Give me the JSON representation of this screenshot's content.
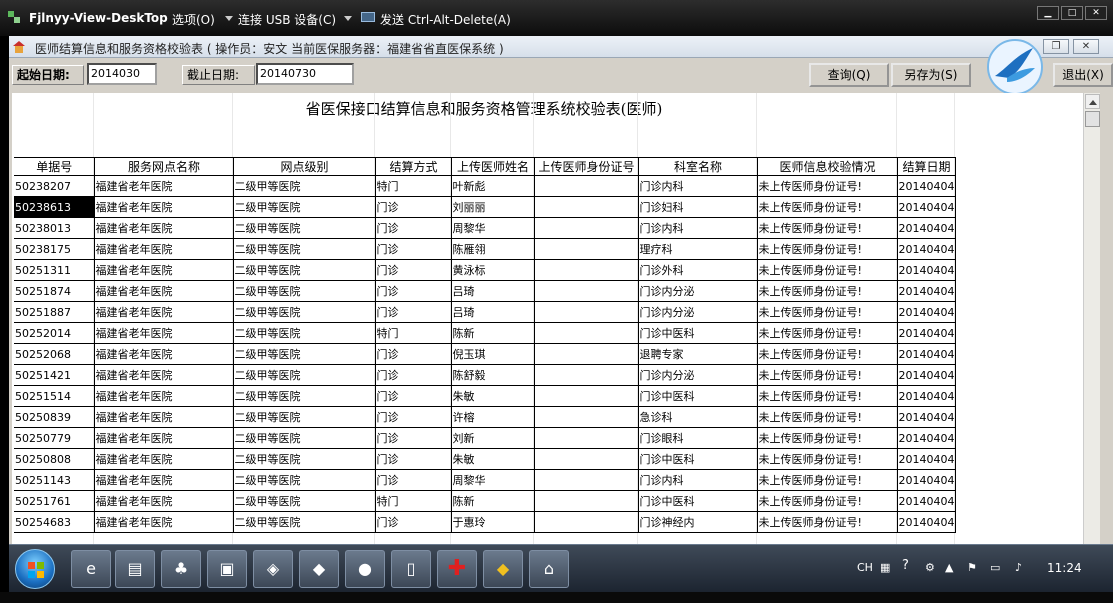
{
  "viewer": {
    "title": "Fjlnyy-View-DeskTop",
    "menus": [
      "选项(O)",
      "连接 USB 设备(C)",
      "发送 Ctrl-Alt-Delete(A)"
    ],
    "window_buttons": [
      "▁",
      "□",
      "✕"
    ]
  },
  "app": {
    "title": "医师结算信息和服务资格校验表 ( 操作员：安文 当前医保服务器：福建省省直医保系统 )",
    "title_buttons": [
      "❐",
      "✕"
    ],
    "start_label": "起始日期:",
    "start_value": "2014030",
    "end_label": "截止日期:",
    "end_value": "20140730",
    "btn_query": "查询(Q)",
    "btn_saveas": "另存为(S)",
    "btn_exit": "退出(X)"
  },
  "report": {
    "title": "省医保接口结算信息和服务资格管理系统校验表(医师)",
    "columns": [
      "单据号",
      "服务网点名称",
      "网点级别",
      "结算方式",
      "上传医师姓名",
      "上传医师身份证号",
      "科室名称",
      "医师信息校验情况",
      "结算日期"
    ],
    "rows": [
      [
        "50238207",
        "福建省老年医院",
        "二级甲等医院",
        "特门",
        "叶新彪",
        "",
        "门诊内科",
        "未上传医师身份证号!",
        "20140404"
      ],
      [
        "50238613",
        "福建省老年医院",
        "二级甲等医院",
        "门诊",
        "刘丽丽",
        "",
        "门诊妇科",
        "未上传医师身份证号!",
        "20140404"
      ],
      [
        "50238013",
        "福建省老年医院",
        "二级甲等医院",
        "门诊",
        "周黎华",
        "",
        "门诊内科",
        "未上传医师身份证号!",
        "20140404"
      ],
      [
        "50238175",
        "福建省老年医院",
        "二级甲等医院",
        "门诊",
        "陈雁翎",
        "",
        "理疗科",
        "未上传医师身份证号!",
        "20140404"
      ],
      [
        "50251311",
        "福建省老年医院",
        "二级甲等医院",
        "门诊",
        "黄泳标",
        "",
        "门诊外科",
        "未上传医师身份证号!",
        "20140404"
      ],
      [
        "50251874",
        "福建省老年医院",
        "二级甲等医院",
        "门诊",
        "吕琦",
        "",
        "门诊内分泌",
        "未上传医师身份证号!",
        "20140404"
      ],
      [
        "50251887",
        "福建省老年医院",
        "二级甲等医院",
        "门诊",
        "吕琦",
        "",
        "门诊内分泌",
        "未上传医师身份证号!",
        "20140404"
      ],
      [
        "50252014",
        "福建省老年医院",
        "二级甲等医院",
        "特门",
        "陈新",
        "",
        "门诊中医科",
        "未上传医师身份证号!",
        "20140404"
      ],
      [
        "50252068",
        "福建省老年医院",
        "二级甲等医院",
        "门诊",
        "倪玉琪",
        "",
        "退聘专家",
        "未上传医师身份证号!",
        "20140404"
      ],
      [
        "50251421",
        "福建省老年医院",
        "二级甲等医院",
        "门诊",
        "陈舒毅",
        "",
        "门诊内分泌",
        "未上传医师身份证号!",
        "20140404"
      ],
      [
        "50251514",
        "福建省老年医院",
        "二级甲等医院",
        "门诊",
        "朱敏",
        "",
        "门诊中医科",
        "未上传医师身份证号!",
        "20140404"
      ],
      [
        "50250839",
        "福建省老年医院",
        "二级甲等医院",
        "门诊",
        "许榕",
        "",
        "急诊科",
        "未上传医师身份证号!",
        "20140404"
      ],
      [
        "50250779",
        "福建省老年医院",
        "二级甲等医院",
        "门诊",
        "刘新",
        "",
        "门诊眼科",
        "未上传医师身份证号!",
        "20140404"
      ],
      [
        "50250808",
        "福建省老年医院",
        "二级甲等医院",
        "门诊",
        "朱敏",
        "",
        "门诊中医科",
        "未上传医师身份证号!",
        "20140404"
      ],
      [
        "50251143",
        "福建省老年医院",
        "二级甲等医院",
        "门诊",
        "周黎华",
        "",
        "门诊内科",
        "未上传医师身份证号!",
        "20140404"
      ],
      [
        "50251761",
        "福建省老年医院",
        "二级甲等医院",
        "特门",
        "陈新",
        "",
        "门诊中医科",
        "未上传医师身份证号!",
        "20140404"
      ],
      [
        "50254683",
        "福建省老年医院",
        "二级甲等医院",
        "门诊",
        "于惠玲",
        "",
        "门诊神经内",
        "未上传医师身份证号!",
        "20140404"
      ]
    ],
    "selected_cell": "50238613"
  },
  "taskbar": {
    "apps": [
      "ie-icon",
      "explorer-icon",
      "app-icon",
      "app-icon",
      "app-icon",
      "app-icon",
      "firefox-icon",
      "notepad-icon",
      "medical-cross-icon",
      "app-icon",
      "app-icon"
    ],
    "tray_lang": "CH",
    "clock": "11:24"
  }
}
